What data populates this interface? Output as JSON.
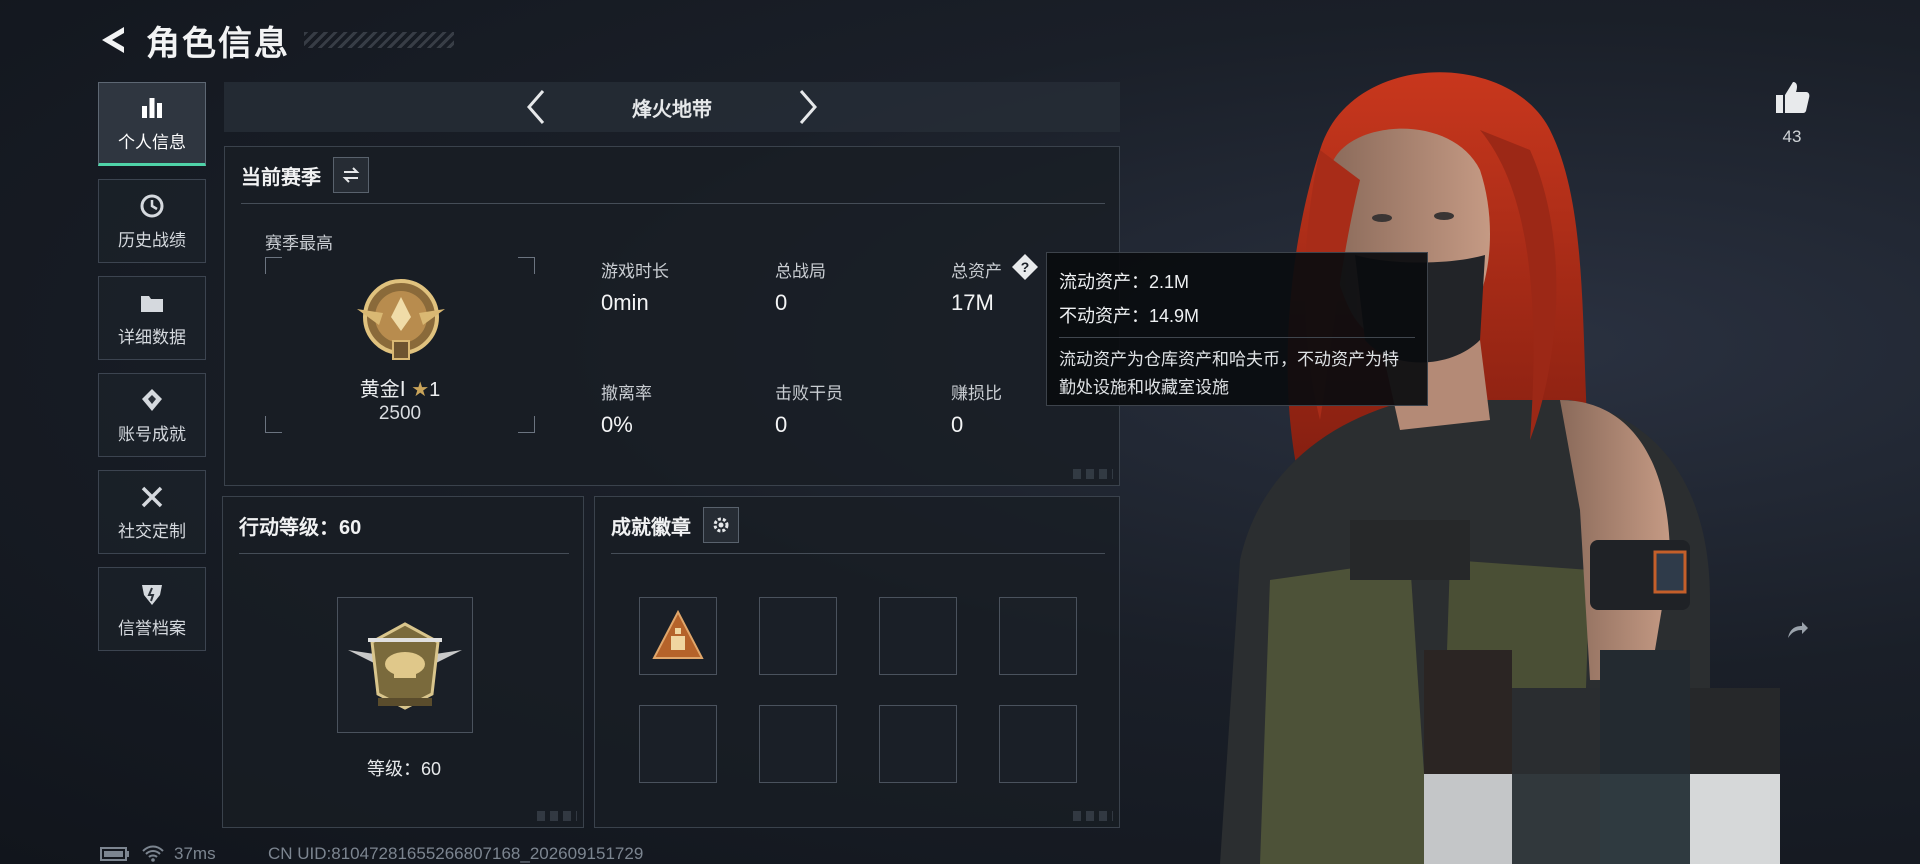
{
  "header": {
    "title": "角色信息"
  },
  "sidebar": {
    "items": [
      {
        "label": "个人信息",
        "icon": "bar-chart-icon"
      },
      {
        "label": "历史战绩",
        "icon": "history-clock-icon"
      },
      {
        "label": "详细数据",
        "icon": "folder-icon"
      },
      {
        "label": "账号成就",
        "icon": "achievement-icon"
      },
      {
        "label": "社交定制",
        "icon": "tools-icon"
      },
      {
        "label": "信誉档案",
        "icon": "credit-shield-icon"
      }
    ]
  },
  "mode": {
    "title": "烽火地带"
  },
  "season": {
    "title": "当前赛季",
    "best_label": "赛季最高",
    "rank_name": "黄金Ⅰ",
    "rank_star": "1",
    "rank_score": "2500",
    "stats": [
      {
        "label": "游戏时长",
        "value": "0min"
      },
      {
        "label": "总战局",
        "value": "0"
      },
      {
        "label": "总资产",
        "value": "17M"
      },
      {
        "label": "撤离率",
        "value": "0%"
      },
      {
        "label": "击败干员",
        "value": "0"
      },
      {
        "label": "赚损比",
        "value": "0"
      }
    ]
  },
  "tooltip": {
    "liquid": "流动资产：2.1M",
    "fixed": "不动资产：14.9M",
    "desc": "流动资产为仓库资产和哈夫币，不动资产为特勤处设施和收藏室设施"
  },
  "action": {
    "title": "行动等级：60",
    "level_text": "等级：60"
  },
  "achievements": {
    "title": "成就徽章"
  },
  "likes": {
    "count": "43"
  },
  "status": {
    "ping": "37ms",
    "uid": "CN UID:810472816552668071​68_202609151729"
  },
  "colors": {
    "accent": "#4fd3a8",
    "gold": "#c9a45a",
    "hair": "#b8321c"
  }
}
